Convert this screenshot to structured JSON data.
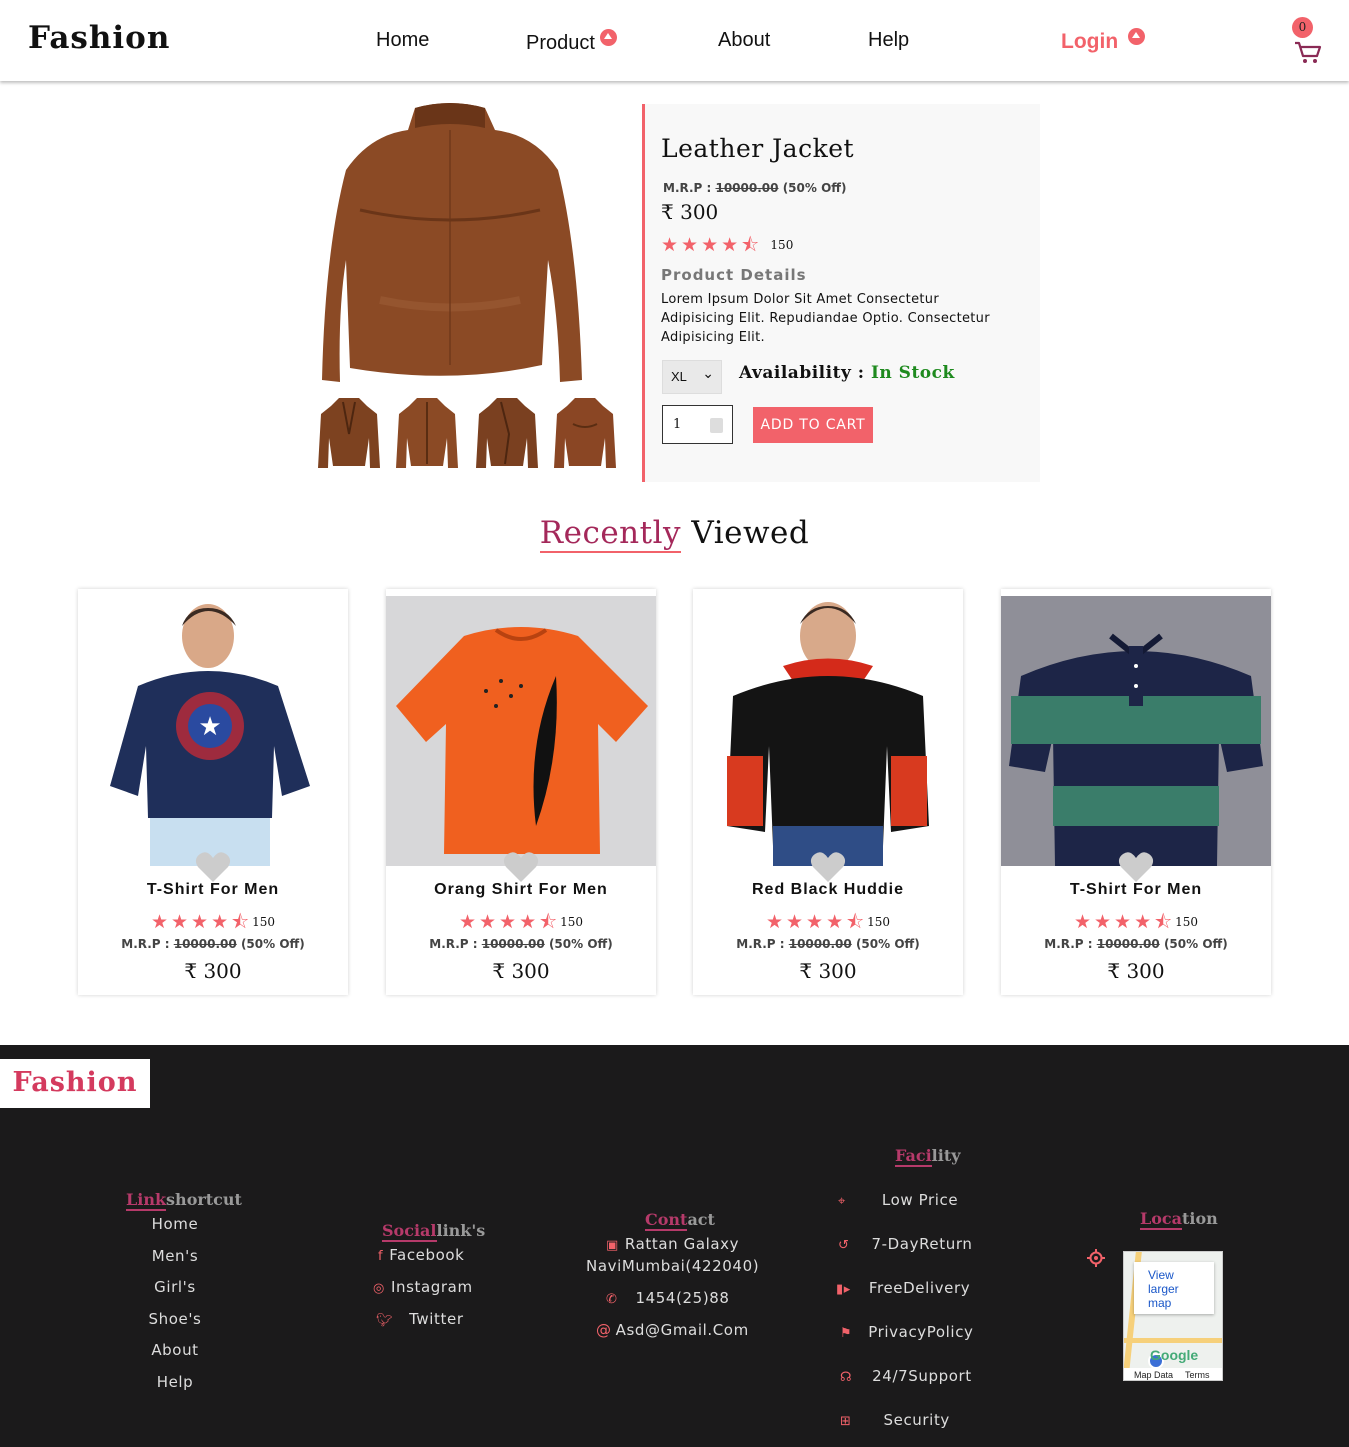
{
  "header": {
    "brand": "Fashion",
    "nav": [
      "Home",
      "Product",
      "About",
      "Help"
    ],
    "login": "Login",
    "cart_count": "0"
  },
  "product": {
    "title": "Leather Jacket",
    "mrp_label": "M.R.P :",
    "mrp_value": "10000.00",
    "discount": "(50% Off)",
    "currency": "₹",
    "price": "300",
    "rating_stars": 4.5,
    "rating_count": "150",
    "details_heading": "Product Details",
    "description": "Lorem Ipsum Dolor Sit Amet Consectetur Adipisicing Elit. Repudiandae Optio. Consectetur Adipisicing Elit.",
    "size": "XL",
    "availability_label": "Availability :",
    "availability_value": "In Stock",
    "quantity": "1",
    "add_to_cart": "ADD TO CART",
    "colors": {
      "accent": "#f2626a",
      "in_stock": "#1e8a1e"
    }
  },
  "recently_viewed": {
    "title_highlight": "Recently",
    "title_rest": "Viewed",
    "items": [
      {
        "name": "T-Shirt For Men",
        "rating_count": "150",
        "mrp_label": "M.R.P :",
        "mrp_value": "10000.00",
        "discount": "(50% Off)",
        "currency": "₹",
        "price": "300"
      },
      {
        "name": "Orang Shirt For Men",
        "rating_count": "150",
        "mrp_label": "M.R.P :",
        "mrp_value": "10000.00",
        "discount": "(50% Off)",
        "currency": "₹",
        "price": "300"
      },
      {
        "name": "Red Black Huddie",
        "rating_count": "150",
        "mrp_label": "M.R.P :",
        "mrp_value": "10000.00",
        "discount": "(50% Off)",
        "currency": "₹",
        "price": "300"
      },
      {
        "name": "T-Shirt For Men",
        "rating_count": "150",
        "mrp_label": "M.R.P :",
        "mrp_value": "10000.00",
        "discount": "(50% Off)",
        "currency": "₹",
        "price": "300"
      }
    ]
  },
  "footer": {
    "brand": "Fashion",
    "shortcut": {
      "head_hl": "Link",
      "head_rest": "shortcut",
      "items": [
        "Home",
        "Men's",
        "Girl's",
        "Shoe's",
        "About",
        "Help"
      ]
    },
    "social": {
      "head_hl": "Social",
      "head_rest": "link's",
      "items": [
        "Facebook",
        "Instagram",
        "Twitter"
      ]
    },
    "contact": {
      "head_hl": "Cont",
      "head_rest": "act",
      "address_1": "Rattan Galaxy",
      "address_2": "NaviMumbai(422040)",
      "phone": "1454(25)88",
      "email": "Asd@Gmail.Com"
    },
    "facility": {
      "head_hl": "Faci",
      "head_rest": "lity",
      "items": [
        "Low Price",
        "7-DayReturn",
        "FreeDelivery",
        "PrivacyPolicy",
        "24/7Support",
        "Security"
      ]
    },
    "location": {
      "head_hl": "Loca",
      "head_rest": "tion",
      "map_link": "View larger map",
      "map_brand": "Google",
      "map_data": "Map Data",
      "map_terms": "Terms"
    }
  }
}
